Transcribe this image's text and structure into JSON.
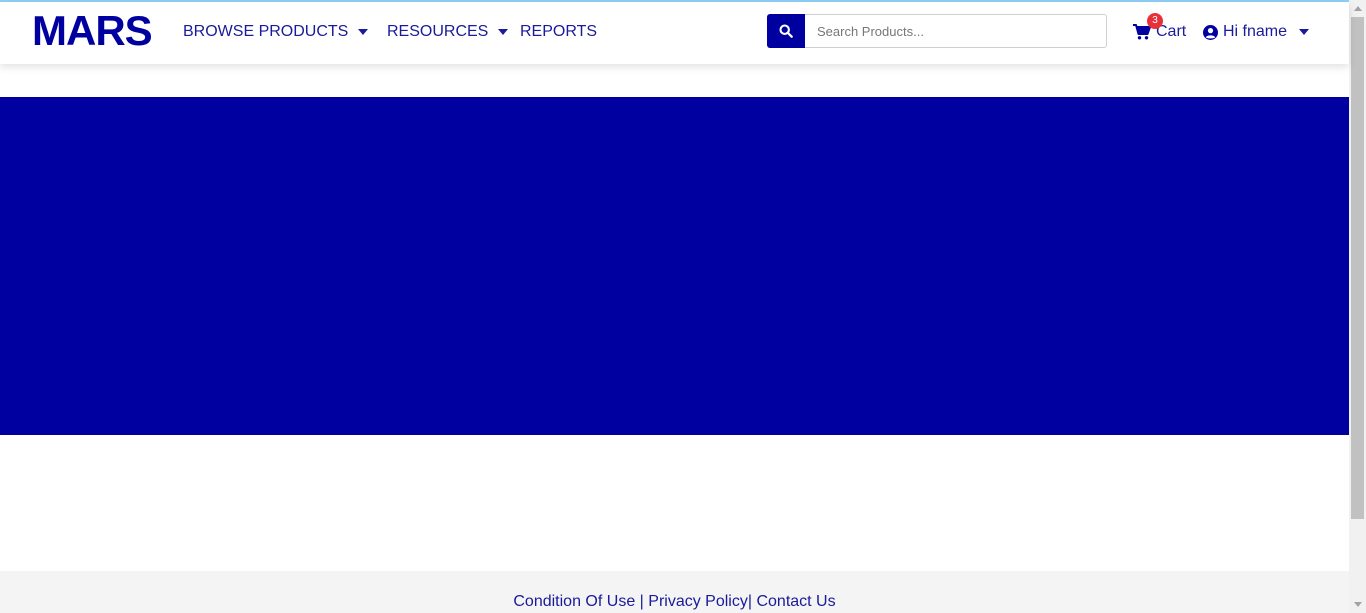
{
  "brand": {
    "logo_text": "MARS",
    "primary_color": "#0000a0",
    "link_color": "#1a1a9a"
  },
  "nav": {
    "browse_products": "BROWSE PRODUCTS",
    "resources": "RESOURCES",
    "reports": "REPORTS"
  },
  "search": {
    "placeholder": "Search Products...",
    "icon": "search-icon"
  },
  "cart": {
    "label": "Cart",
    "count": "3",
    "icon": "shopping-cart-icon",
    "badge_color": "#e8303a"
  },
  "user": {
    "greeting": "Hi fname",
    "icon": "user-circle-icon"
  },
  "banner": {
    "color": "#0000a0"
  },
  "footer": {
    "condition_of_use": "Condition Of Use",
    "privacy_policy": "Privacy Policy",
    "contact_us": "Contact Us",
    "separator": "|"
  }
}
